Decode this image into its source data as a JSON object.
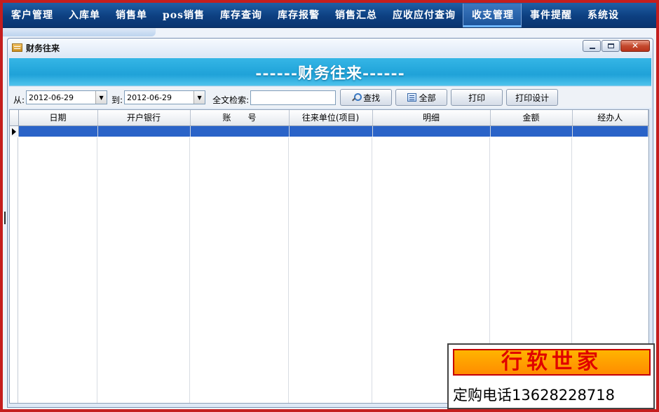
{
  "nav": {
    "items": [
      {
        "label": "客户管理"
      },
      {
        "label": "入库单"
      },
      {
        "label": "销售单"
      },
      {
        "label": "pos销售"
      },
      {
        "label": "库存查询"
      },
      {
        "label": "库存报警"
      },
      {
        "label": "销售汇总"
      },
      {
        "label": "应收应付查询"
      },
      {
        "label": "收支管理",
        "active": true
      },
      {
        "label": "事件提醒"
      },
      {
        "label": "系统设"
      }
    ]
  },
  "window": {
    "title": "财务往来",
    "banner": "------财务往来------"
  },
  "toolbar": {
    "from_label": "从:",
    "from_date": "2012-06-29",
    "to_label": "到:",
    "to_date": "2012-06-29",
    "search_label": "全文检索:",
    "search_value": "",
    "find_button": "查找",
    "all_button": "全部",
    "print_button": "打印",
    "print_design_button": "打印设计"
  },
  "grid": {
    "columns": [
      "日期",
      "开户银行",
      "账　　号",
      "往来单位(项目)",
      "明细",
      "金额",
      "经办人"
    ],
    "rows": []
  },
  "ad": {
    "title": "行软世家",
    "phone": "定购电话13628228718"
  },
  "colors": {
    "nav_bg": "#0d3f80",
    "banner": "#1fa2d8",
    "selected_row": "#2a63c8",
    "frame": "#c41e1e"
  }
}
